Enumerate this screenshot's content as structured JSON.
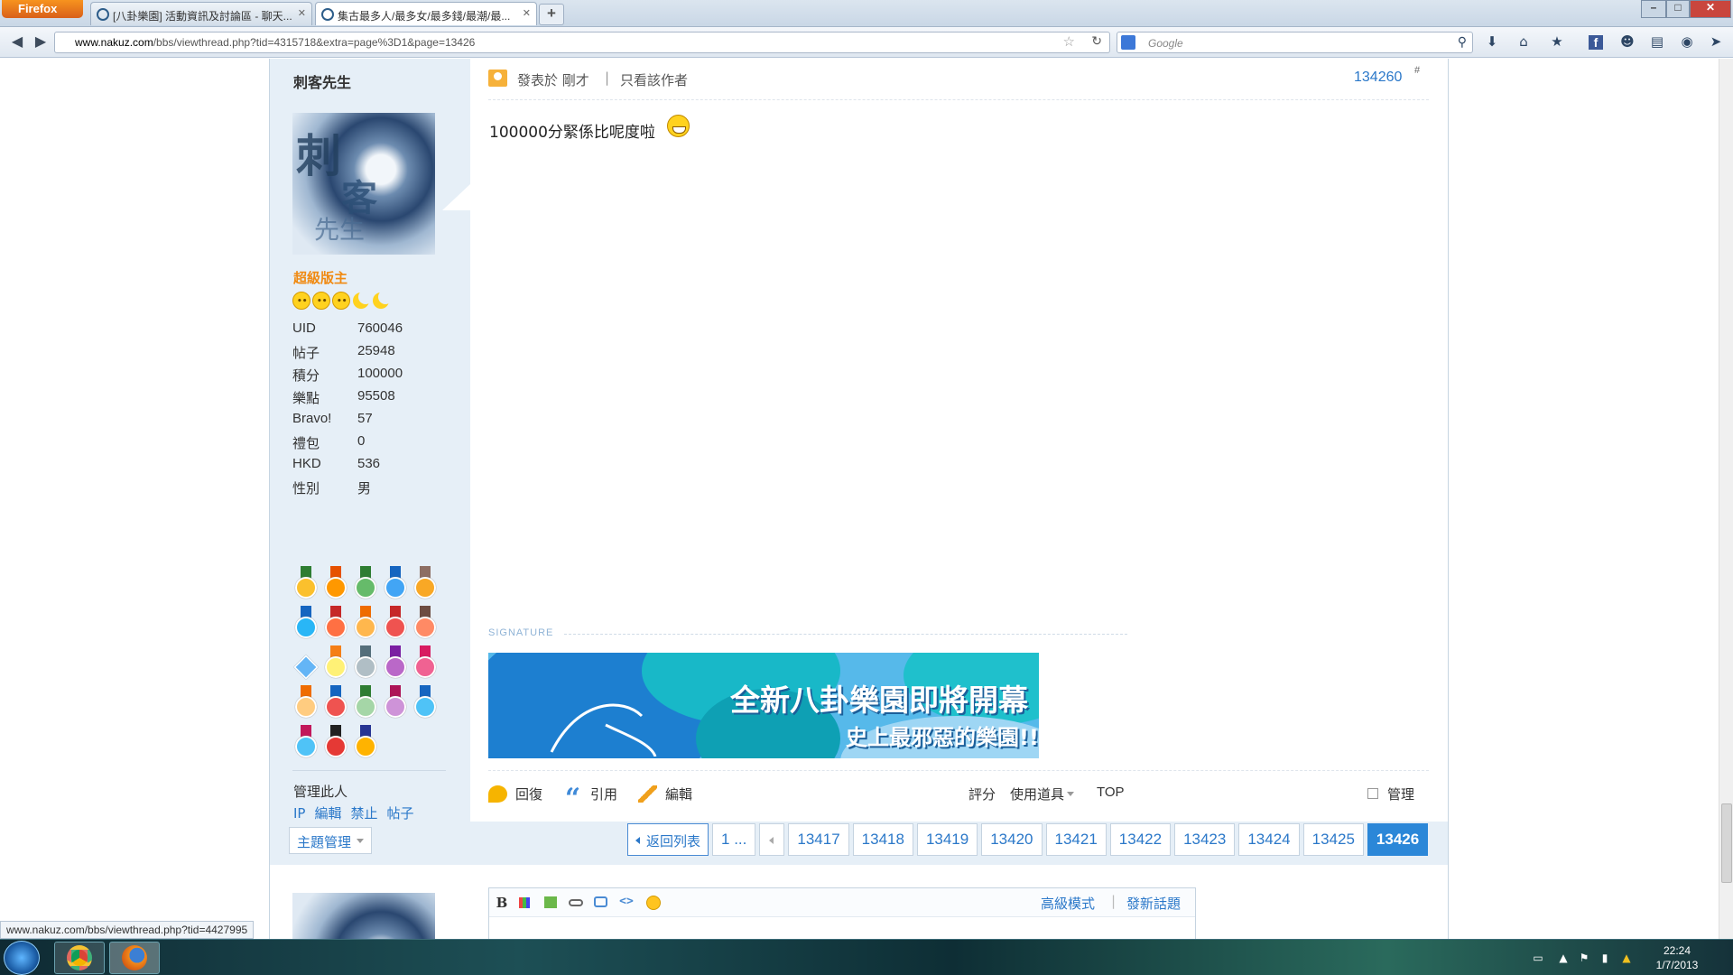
{
  "browser": {
    "menu_button": "Firefox",
    "tabs": [
      {
        "title": "[八卦樂園] 活動資訊及討論區 - 聊天...",
        "active": false
      },
      {
        "title": "集古最多人/最多女/最多錢/最潮/最...",
        "active": true
      }
    ],
    "new_tab_symbol": "+",
    "url_domain": "www.nakuz.com",
    "url_path": "/bbs/viewthread.php?tid=4315718&extra=page%3D1&page=13426",
    "search_placeholder": "Google",
    "window_buttons": [
      "–",
      "□",
      "✕"
    ],
    "toolbar_icons": [
      "download-icon",
      "home-icon",
      "bookmarks-icon",
      "facebook-icon",
      "people-icon",
      "chat-icon",
      "globe-icon",
      "send-icon"
    ]
  },
  "author": {
    "name": "刺客先生",
    "avatar_text": [
      "刺",
      "客",
      "先生"
    ],
    "rank": "超級版主",
    "stats": [
      {
        "key": "UID",
        "value": "760046"
      },
      {
        "key": "帖子",
        "value": "25948"
      },
      {
        "key": "積分",
        "value": "100000"
      },
      {
        "key": "樂點",
        "value": "95508"
      },
      {
        "key": "Bravo!",
        "value": "57"
      },
      {
        "key": "禮包",
        "value": "0"
      },
      {
        "key": "HKD",
        "value": "536"
      },
      {
        "key": "性別",
        "value": "男"
      }
    ],
    "manage_label": "管理此人",
    "manage_links": [
      "IP",
      "編輯",
      "禁止",
      "帖子"
    ]
  },
  "post": {
    "posted_label": "發表於 剛才",
    "separator": "|",
    "only_author": "只看該作者",
    "number": "134260",
    "hash": "#",
    "text": "100000分緊係比呢度啦",
    "signature_label": "SIGNATURE",
    "banner_line1": "全新八卦樂園即將開幕",
    "banner_line2": "史上最邪惡的樂園!!",
    "actions": {
      "reply": "回復",
      "quote": "引用",
      "edit": "編輯",
      "rate": "評分",
      "tools": "使用道具",
      "top": "TOP",
      "manage": "管理"
    }
  },
  "pager": {
    "topic_manage": "主題管理",
    "back": "返回列表",
    "first": "1 ...",
    "pages": [
      "13417",
      "13418",
      "13419",
      "13420",
      "13421",
      "13422",
      "13423",
      "13424",
      "13425"
    ],
    "current": "13426"
  },
  "editor": {
    "bold": "B",
    "advanced_mode": "高級模式",
    "separator": "|",
    "new_topic": "發新話題"
  },
  "status_url": "www.nakuz.com/bbs/viewthread.php?tid=4427995",
  "clock": {
    "time": "22:24",
    "date": "1/7/2013"
  },
  "colors": {
    "link": "#2b78c9",
    "rank": "#f08a12",
    "sidebar_bg": "#e6eff7",
    "current_page": "#2b87d8"
  }
}
